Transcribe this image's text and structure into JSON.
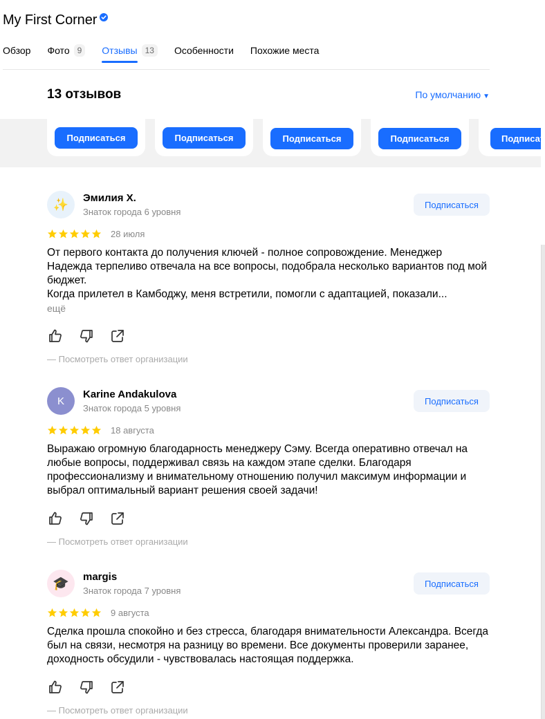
{
  "header": {
    "title": "My First Corner",
    "verified_icon": "verified-badge-icon",
    "accent": "#196dff"
  },
  "tabs": [
    {
      "label": "Обзор",
      "count": ""
    },
    {
      "label": "Фото",
      "count": "9"
    },
    {
      "label": "Отзывы",
      "count": "13",
      "active": true
    },
    {
      "label": "Особенности",
      "count": ""
    },
    {
      "label": "Похожие места",
      "count": ""
    }
  ],
  "reviews_header": {
    "count_label": "13 отзывов",
    "sort_label": "По умолчанию"
  },
  "subscribe_strip": {
    "button_label": "Подписаться"
  },
  "reviews": [
    {
      "author": "Эмилия Х.",
      "level": "Знаток города 6 уровня",
      "avatar_icon": "sparkles-icon",
      "avatar_glyph": "✨",
      "follow_label": "Подписаться",
      "rating": 5,
      "date": "28 июля",
      "text": [
        "От первого контакта до получения ключей - полное сопровождение. Менеджер Надежда терпеливо отвечала на все вопросы, подобрала несколько вариантов под мой бюджет.",
        "Когда прилетел в Камбоджу, меня встретили, помогли с адаптацией, показали..."
      ],
      "more_label": "ещё",
      "org_answer_label": "—  Посмотреть ответ организации"
    },
    {
      "author": "Karine Andakulova",
      "level": "Знаток города 5 уровня",
      "avatar_icon": "letter-avatar",
      "avatar_glyph": "K",
      "follow_label": "Подписаться",
      "rating": 5,
      "date": "18 августа",
      "text": [
        "Выражаю огромную благодарность менеджеру Сэму. Всегда оперативно отвечал на любые вопросы, поддерживал связь на каждом этапе сделки. Благодаря профессионализму и внимательному отношению получил максимум информации и выбрал оптимальный вариант решения своей задачи!"
      ],
      "org_answer_label": "—  Посмотреть ответ организации"
    },
    {
      "author": "margis",
      "level": "Знаток города 7 уровня",
      "avatar_icon": "graduation-cap-icon",
      "avatar_glyph": "🎓",
      "follow_label": "Подписаться",
      "rating": 5,
      "date": "9 августа",
      "text": [
        "Сделка прошла спокойно и без стресса, благодаря внимательности Александра. Всегда был на связи, несмотря на разницу во времени. Все документы проверили заранее, доходность обсудили - чувствовалась настоящая поддержка."
      ],
      "org_answer_label": "—  Посмотреть ответ организации"
    }
  ],
  "icons": {
    "like": "thumbs-up-icon",
    "dislike": "thumbs-down-icon",
    "share": "share-icon",
    "star_color": "#fc0"
  }
}
